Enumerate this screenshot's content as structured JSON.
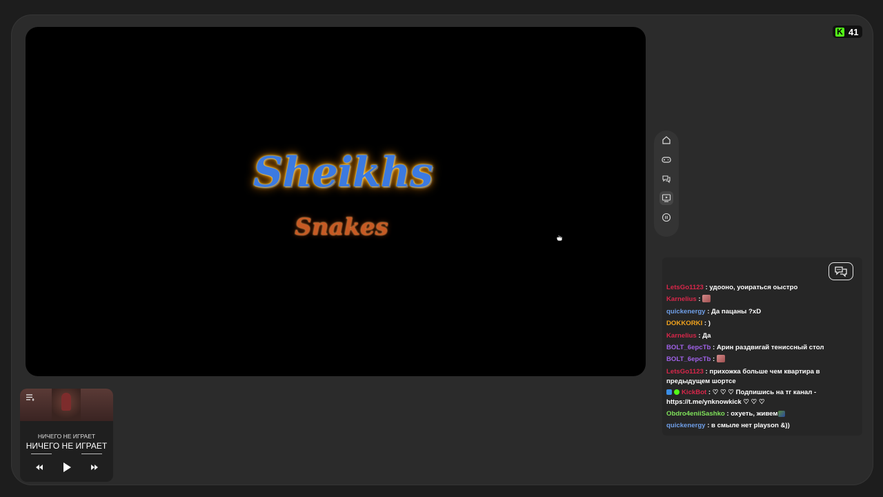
{
  "badge": {
    "viewer_count": "41",
    "logo_letter": "K"
  },
  "video": {
    "game_title": "Sheikhs",
    "game_subtitle": "Snakes"
  },
  "nav": {
    "items": [
      {
        "name": "home",
        "icon": "home-icon"
      },
      {
        "name": "games",
        "icon": "gamepad-icon"
      },
      {
        "name": "chat",
        "icon": "chat-icon"
      },
      {
        "name": "stream",
        "icon": "play-screen-icon"
      },
      {
        "name": "pause",
        "icon": "pause-icon"
      }
    ]
  },
  "chat": {
    "toggle_icon": "chat-bubbles-icon",
    "messages": [
      {
        "user": "LetsGo1123",
        "color": "#d9264a",
        "text": ": удоонo, уоиратьcя оыcтро",
        "emote": false
      },
      {
        "user": "Karnelius",
        "color": "#d9264a",
        "text": ": ",
        "emote": true
      },
      {
        "user": "quickenergy",
        "color": "#6f9fe8",
        "text": ": Да пацаны ?xD",
        "emote": false
      },
      {
        "user": "DOKKORKI",
        "color": "#f0a21d",
        "text": ": )",
        "emote": false
      },
      {
        "user": "Karnelius",
        "color": "#d9264a",
        "text": ": Да",
        "emote": false
      },
      {
        "user": "BOLT_6epcTb",
        "color": "#a061e8",
        "text": ": Арин раздвигай тениcсный стол",
        "emote": false
      },
      {
        "user": "BOLT_6epcTb",
        "color": "#a061e8",
        "text": ": ",
        "emote": true
      },
      {
        "user": "LetsGo1123",
        "color": "#d9264a",
        "text": ": прихожка больше чем квартира в предыдущем шортсе",
        "emote": false,
        "wrap": true
      },
      {
        "user": "KickBot",
        "color": "#d9264a",
        "text": ": ♡ ♡ ♡ Подпишись на тг канал - https://t.me/ynknowkick ♡ ♡ ♡",
        "emote": false,
        "wrap": true,
        "badges": true
      },
      {
        "user": "Obdro4eniiSashko",
        "color": "#7fe25a",
        "text": ": охуеть, живем",
        "emote": true,
        "small_emote": true
      },
      {
        "user": "quickenergy",
        "color": "#6f9fe8",
        "text": ": в смыле нет playson &))",
        "emote": false
      }
    ]
  },
  "player": {
    "track_title": "НИЧЕГО НЕ ИГРАЕТ",
    "artist": "НИЧЕГО НЕ ИГРАЕТ",
    "progress": 0,
    "queue_icon": "queue-icon",
    "prev_icon": "previous-icon",
    "play_icon": "play-icon",
    "next_icon": "next-icon"
  }
}
